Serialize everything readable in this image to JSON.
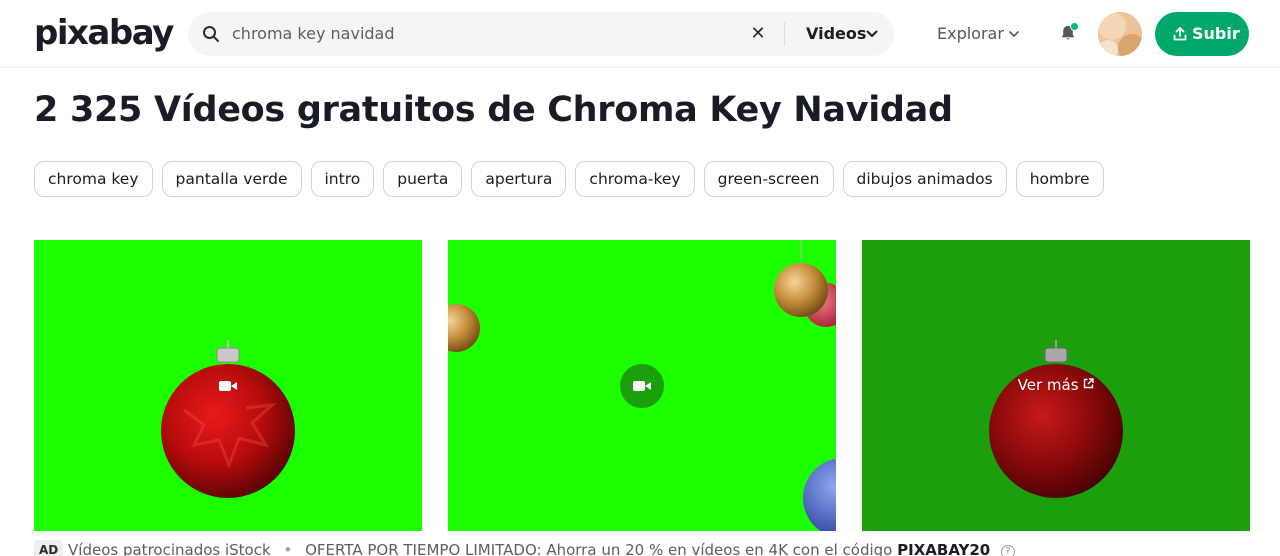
{
  "header": {
    "logo": "pixabay",
    "search": {
      "value": "chroma key navidad",
      "placeholder": "Buscar"
    },
    "media_type": "Videos",
    "explore_label": "Explorar",
    "upload_label": "Subir",
    "colors": {
      "accent": "#02a86b",
      "notification_dot": "#02be6e"
    }
  },
  "main": {
    "title": "2 325 Vídeos gratuitos de Chroma Key Navidad",
    "tags": [
      "chroma key",
      "pantalla verde",
      "intro",
      "puerta",
      "apertura",
      "chroma-key",
      "green-screen",
      "dibujos animados",
      "hombre"
    ],
    "videos": [
      {
        "icon": "video-camera-icon",
        "background": "#1cff00"
      },
      {
        "icon": "video-camera-icon",
        "background": "#1cff00"
      },
      {
        "hover_label": "Ver más",
        "icon": "external-link-icon",
        "background": "#1c9f0c"
      }
    ]
  },
  "ad_bar": {
    "badge": "AD",
    "sponsor": "Vídeos patrocinados iStock",
    "separator": "•",
    "offer": "OFERTA POR TIEMPO LIMITADO: Ahorra un 20 % en vídeos en 4K con el código",
    "code": "PIXABAY20",
    "help_icon": "question-circle-icon"
  }
}
